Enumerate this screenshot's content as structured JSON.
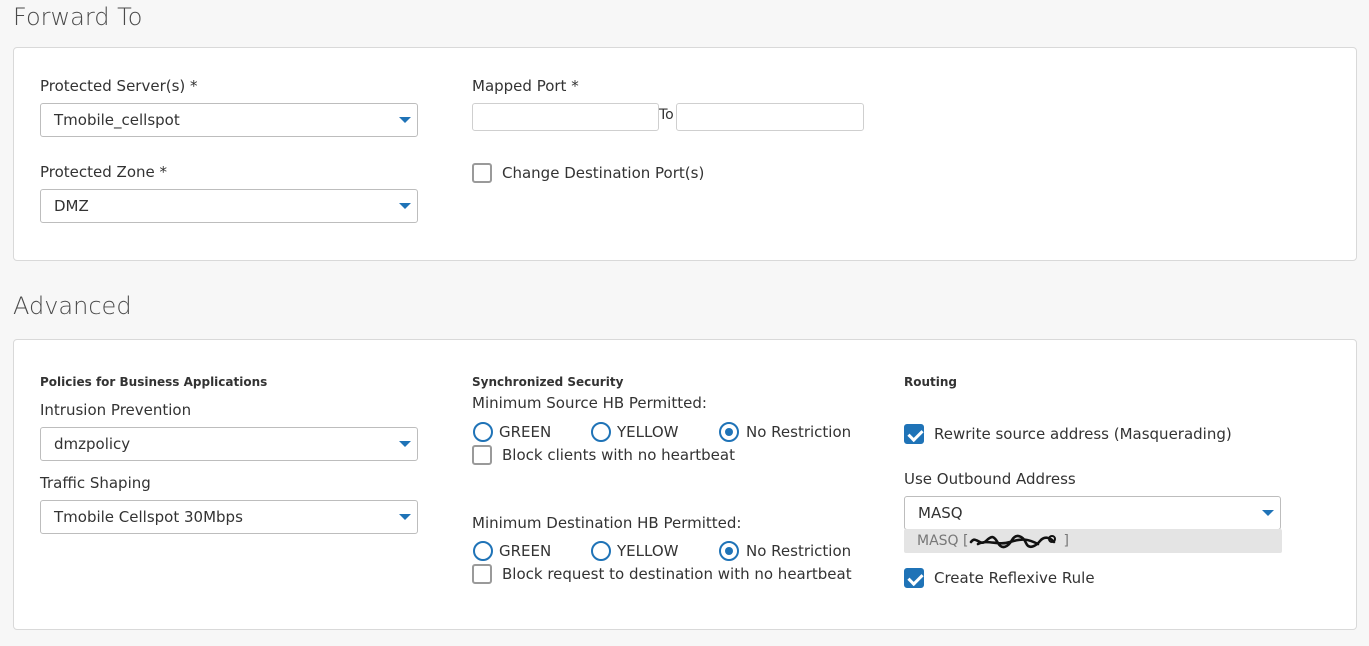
{
  "forward_to": {
    "title": "Forward To",
    "protected_servers": {
      "label": "Protected Server(s) *",
      "value": "Tmobile_cellspot"
    },
    "protected_zone": {
      "label": "Protected Zone *",
      "value": "DMZ"
    },
    "mapped_port": {
      "label": "Mapped Port *",
      "from_value": "",
      "to_label": "To",
      "to_value": ""
    },
    "change_destination_port": {
      "label": "Change Destination Port(s)",
      "checked": false
    }
  },
  "advanced": {
    "title": "Advanced",
    "policies": {
      "title": "Policies for Business Applications",
      "intrusion_prevention": {
        "label": "Intrusion Prevention",
        "value": "dmzpolicy"
      },
      "traffic_shaping": {
        "label": "Traffic Shaping",
        "value": "Tmobile Cellspot 30Mbps"
      }
    },
    "sync_security": {
      "title": "Synchronized Security",
      "min_source": {
        "label": "Minimum Source HB Permitted:",
        "options": [
          "GREEN",
          "YELLOW",
          "No Restriction"
        ],
        "selected": "No Restriction"
      },
      "block_clients": {
        "label": "Block clients with no heartbeat",
        "checked": false
      },
      "min_destination": {
        "label": "Minimum Destination HB Permitted:",
        "options": [
          "GREEN",
          "YELLOW",
          "No Restriction"
        ],
        "selected": "No Restriction"
      },
      "block_request": {
        "label": "Block request to destination with no heartbeat",
        "checked": false
      }
    },
    "routing": {
      "title": "Routing",
      "rewrite_source": {
        "label": "Rewrite source address (Masquerading)",
        "checked": true
      },
      "outbound_address": {
        "label": "Use Outbound Address",
        "value": "MASQ",
        "option": "MASQ [",
        "option_end": "]"
      },
      "reflexive_rule": {
        "label": "Create Reflexive Rule",
        "checked": true
      }
    }
  },
  "colors": {
    "accent": "#1f73b7",
    "panel_border": "#d9d9d9",
    "background": "#f7f7f7"
  }
}
